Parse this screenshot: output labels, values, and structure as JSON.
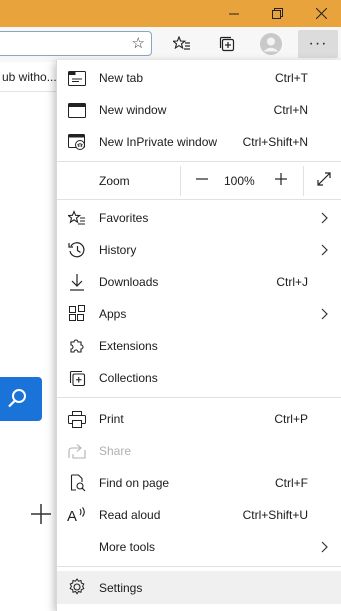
{
  "window": {
    "accent": "#e8a33c"
  },
  "toolbar": {
    "favorites_bar_item": "ub witho...",
    "more_button_label": "···"
  },
  "menu": {
    "new_tab": {
      "label": "New tab",
      "shortcut": "Ctrl+T"
    },
    "new_window": {
      "label": "New window",
      "shortcut": "Ctrl+N"
    },
    "new_inprivate": {
      "label": "New InPrivate window",
      "shortcut": "Ctrl+Shift+N"
    },
    "zoom": {
      "label": "Zoom",
      "value": "100%",
      "minus": "—",
      "plus": "+"
    },
    "favorites": {
      "label": "Favorites"
    },
    "history": {
      "label": "History"
    },
    "downloads": {
      "label": "Downloads",
      "shortcut": "Ctrl+J"
    },
    "apps": {
      "label": "Apps"
    },
    "extensions": {
      "label": "Extensions"
    },
    "collections": {
      "label": "Collections"
    },
    "print": {
      "label": "Print",
      "shortcut": "Ctrl+P"
    },
    "share": {
      "label": "Share"
    },
    "find_on_page": {
      "label": "Find on page",
      "shortcut": "Ctrl+F"
    },
    "read_aloud": {
      "label": "Read aloud",
      "shortcut": "Ctrl+Shift+U"
    },
    "more_tools": {
      "label": "More tools"
    },
    "settings": {
      "label": "Settings"
    }
  },
  "colors": {
    "search_button": "#1a73d8",
    "highlight": "#f0f0f0"
  }
}
